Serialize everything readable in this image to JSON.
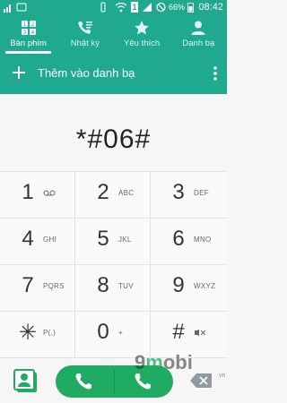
{
  "status_bar": {
    "time": "08:42",
    "battery": "66%",
    "sim_slot": "1"
  },
  "tabs": [
    {
      "label": "Bàn phím",
      "icon": "dialpad-grid-icon",
      "active": true
    },
    {
      "label": "Nhật ký",
      "icon": "call-log-icon",
      "active": false
    },
    {
      "label": "Yêu thích",
      "icon": "star-icon",
      "active": false
    },
    {
      "label": "Danh bạ",
      "icon": "contact-person-icon",
      "active": false
    }
  ],
  "add_contact": {
    "label": "Thêm vào danh bạ",
    "icon": "plus-icon",
    "menu_icon": "more-vert-icon"
  },
  "display": {
    "number": "*#06#"
  },
  "keypad": [
    {
      "digit": "1",
      "letters": "",
      "sub_icon": "voicemail-icon"
    },
    {
      "digit": "2",
      "letters": "ABC"
    },
    {
      "digit": "3",
      "letters": "DEF"
    },
    {
      "digit": "4",
      "letters": "GHI"
    },
    {
      "digit": "5",
      "letters": "JKL"
    },
    {
      "digit": "6",
      "letters": "MNO"
    },
    {
      "digit": "7",
      "letters": "PQRS"
    },
    {
      "digit": "8",
      "letters": "TUV"
    },
    {
      "digit": "9",
      "letters": "WXYZ"
    },
    {
      "digit": "✳",
      "letters": "P(,)"
    },
    {
      "digit": "0",
      "letters": "+"
    },
    {
      "digit": "#",
      "letters": "",
      "sub_icon": "keypad-mute-icon"
    }
  ],
  "bottom": {
    "contacts_icon": "contacts-book-icon",
    "call_sim1_badge": "1",
    "call_sim2_badge": "2",
    "delete_icon": "backspace-icon"
  },
  "watermark": {
    "brand_prefix": "9",
    "brand_o": "m",
    "brand_rest": "obi",
    "brand_sub": "vn"
  },
  "colors": {
    "header_teal": "#1fa98f",
    "call_green": "#1fab61",
    "background": "#f6f6f6"
  }
}
